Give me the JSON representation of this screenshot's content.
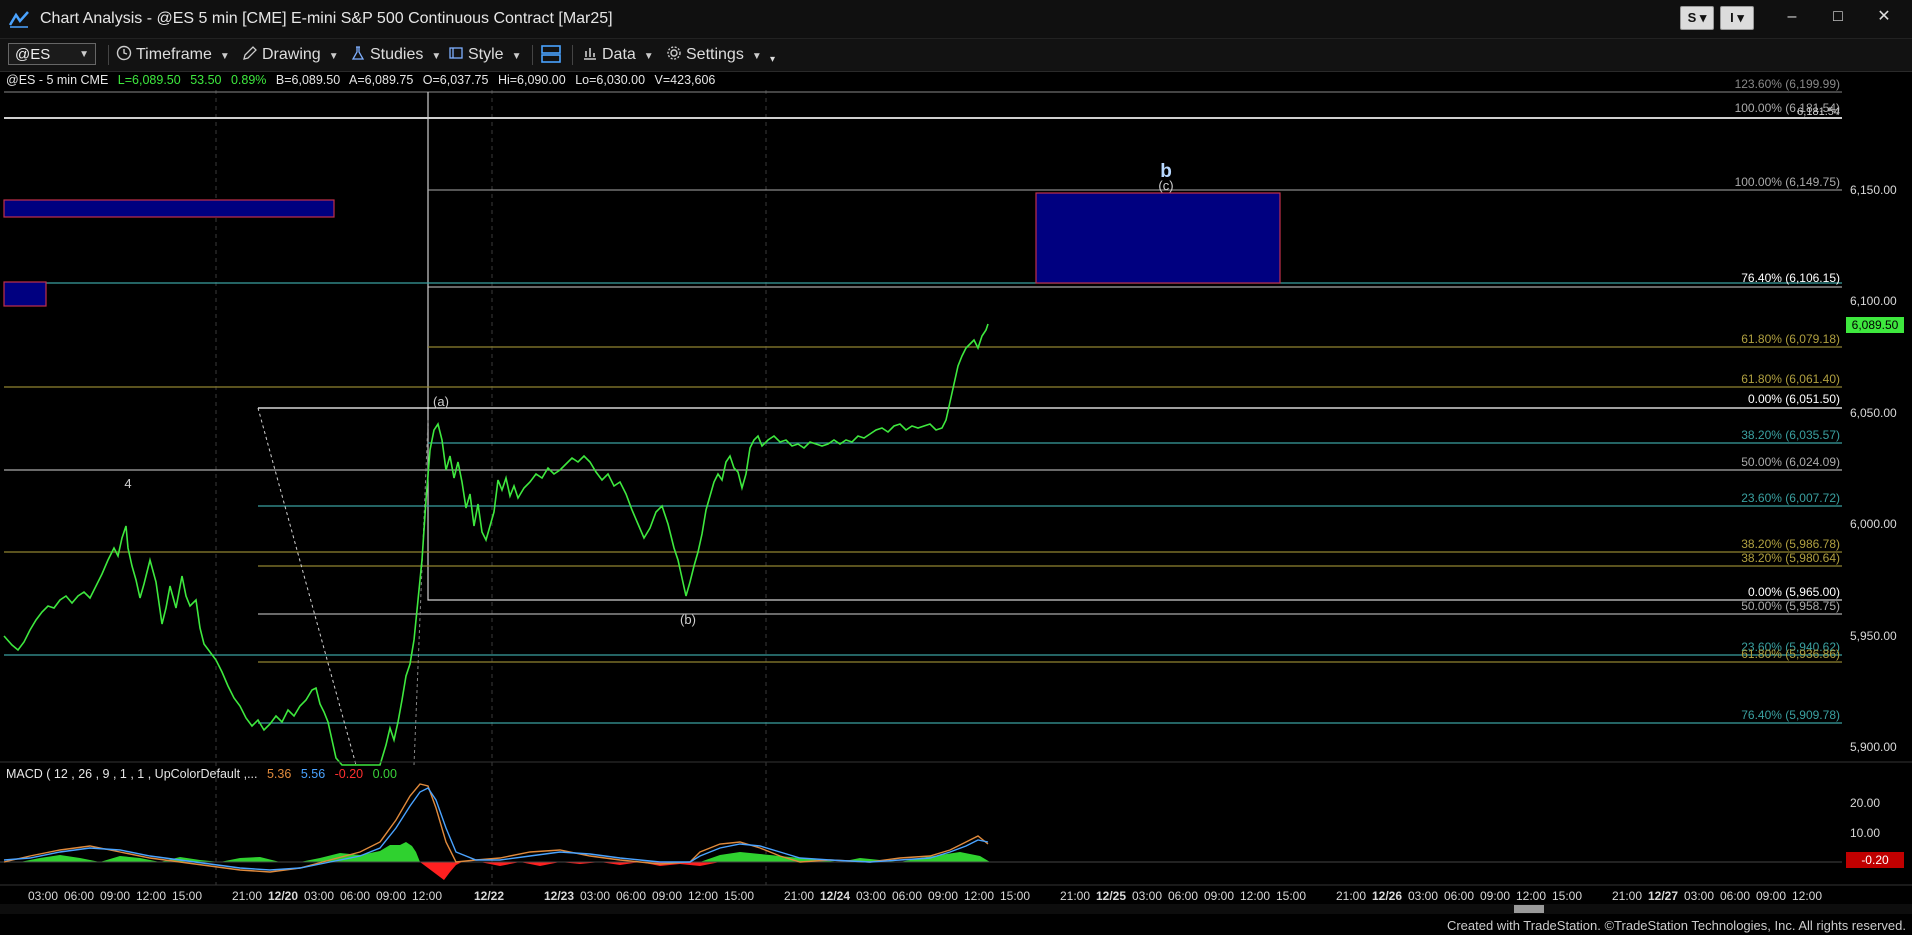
{
  "window": {
    "title": "Chart Analysis - @ES 5 min [CME] E-mini S&P 500 Continuous Contract [Mar25]",
    "btn_s": "S",
    "btn_i": "I",
    "minimize": "–",
    "maximize": "□",
    "close": "✕"
  },
  "toolbar": {
    "symbol": "@ES",
    "timeframe": "Timeframe",
    "drawing": "Drawing",
    "studies": "Studies",
    "style": "Style",
    "data": "Data",
    "settings": "Settings"
  },
  "chart_header": {
    "symbol_info": "@ES - 5 min  CME",
    "last": "L=6,089.50",
    "change": "53.50",
    "pct": "0.89%",
    "bid": "B=6,089.50",
    "ask": "A=6,089.75",
    "open": "O=6,037.75",
    "high": "Hi=6,090.00",
    "low": "Lo=6,030.00",
    "volume": "V=423,606"
  },
  "price_axis": {
    "labels": [
      "6,150.00",
      "6,100.00",
      "6,050.00",
      "6,000.00",
      "5,950.00",
      "5,900.00"
    ],
    "current_price": "6,089.50",
    "top_marker": "6,181.54"
  },
  "fib_levels": [
    {
      "label": "100.00% (6,181.54)",
      "color": "#aaaaaa"
    },
    {
      "label": "100.00% (6,149.75)",
      "color": "#aaaaaa"
    },
    {
      "label": "76.40% (6,106.15)",
      "color": "#ffffff"
    },
    {
      "label": "61.80% (6,079.18)",
      "color": "#b0a040"
    },
    {
      "label": "61.80% (6,061.40)",
      "color": "#b0a040"
    },
    {
      "label": "0.00% (6,051.50)",
      "color": "#ffffff"
    },
    {
      "label": "38.20% (6,035.57)",
      "color": "#3aa0a0"
    },
    {
      "label": "50.00% (6,024.09)",
      "color": "#aaaaaa"
    },
    {
      "label": "23.60% (6,007.72)",
      "color": "#3aa0a0"
    },
    {
      "label": "38.20% (5,986.78)",
      "color": "#b0a040"
    },
    {
      "label": "38.20% (5,980.64)",
      "color": "#b0a040"
    },
    {
      "label": "0.00% (5,965.00)",
      "color": "#ffffff"
    },
    {
      "label": "50.00% (5,958.75)",
      "color": "#aaaaaa"
    },
    {
      "label": "23.60% (5,940.62)",
      "color": "#3aa0a0"
    },
    {
      "label": "61.80% (5,936.86)",
      "color": "#b0a040"
    },
    {
      "label": "76.40% (5,909.78)",
      "color": "#3aa0a0"
    }
  ],
  "wave_labels": {
    "four": "4",
    "a": "(a)",
    "b_small": "(b)",
    "b_big": "b",
    "c": "(c)"
  },
  "macd": {
    "label": "MACD ( 12 , 26 , 9 , 1 , 1 , UpColorDefault ,...",
    "v1": "5.36",
    "v2": "5.56",
    "v3": "-0.20",
    "v4": "0.00",
    "axis": [
      "20.00",
      "10.00"
    ],
    "current": "-0.20",
    "colors": {
      "v1": "#e08a3c",
      "v2": "#4aa3ff",
      "v3": "#ff3030",
      "v4": "#3ad13a"
    }
  },
  "time_axis": {
    "labels": [
      "03:00",
      "06:00",
      "09:00",
      "12:00",
      "15:00",
      "21:00",
      "12/20",
      "03:00",
      "06:00",
      "09:00",
      "12:00",
      "12/22",
      "12/23",
      "03:00",
      "06:00",
      "09:00",
      "12:00",
      "15:00",
      "21:00",
      "12/24",
      "03:00",
      "06:00",
      "09:00",
      "12:00",
      "15:00",
      "21:00",
      "12/25",
      "03:00",
      "06:00",
      "09:00",
      "12:00",
      "15:00",
      "21:00",
      "12/26",
      "03:00",
      "06:00",
      "09:00",
      "12:00",
      "15:00",
      "21:00",
      "12/27",
      "03:00",
      "06:00",
      "09:00",
      "12:00"
    ]
  },
  "credit": "Created with TradeStation. ©TradeStation Technologies, Inc. All rights reserved.",
  "colors": {
    "price_line": "#3ee83e",
    "target_box": "#000080",
    "target_border": "#c0304a"
  }
}
